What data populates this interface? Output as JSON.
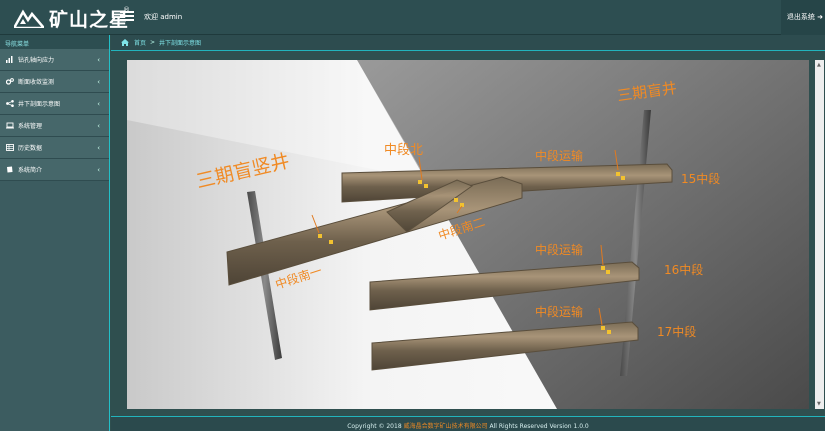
{
  "header": {
    "logo_text": "矿山之星",
    "logo_mark": "®",
    "welcome": "欢迎 admin",
    "logout": "退出系统 ➜"
  },
  "sidebar": {
    "title": "导航菜单",
    "items": [
      {
        "label": "钻孔轴向应力",
        "icon": "bar-chart-icon"
      },
      {
        "label": "断面收敛监测",
        "icon": "gears-icon"
      },
      {
        "label": "井下剖面示意图",
        "icon": "share-nodes-icon"
      },
      {
        "label": "系统管理",
        "icon": "laptop-icon"
      },
      {
        "label": "历史数据",
        "icon": "table-icon"
      },
      {
        "label": "系统简介",
        "icon": "book-icon"
      }
    ],
    "chevron": "‹"
  },
  "breadcrumb": {
    "home": "首页",
    "separator": ">",
    "current": "井下剖面示意图"
  },
  "diagram": {
    "labels": {
      "shaft_left": "三期盲竖井",
      "shaft_right": "三期盲井",
      "north": "中段北",
      "south_two": "中段南二",
      "south_one": "中段南一",
      "transport_15": "中段运输",
      "transport_16": "中段运输",
      "transport_17": "中段运输",
      "level_15": "15中段",
      "level_16": "16中段",
      "level_17": "17中段"
    }
  },
  "footer": {
    "prefix": "Copyright © 2018",
    "company": "威海晶合数字矿山技术有限公司",
    "suffix": "All Rights Reserved Version 1.0.0"
  },
  "colors": {
    "label_orange": "#f08a24",
    "accent_cyan": "#22c0c8",
    "sidebar_bg": "#46676a"
  }
}
